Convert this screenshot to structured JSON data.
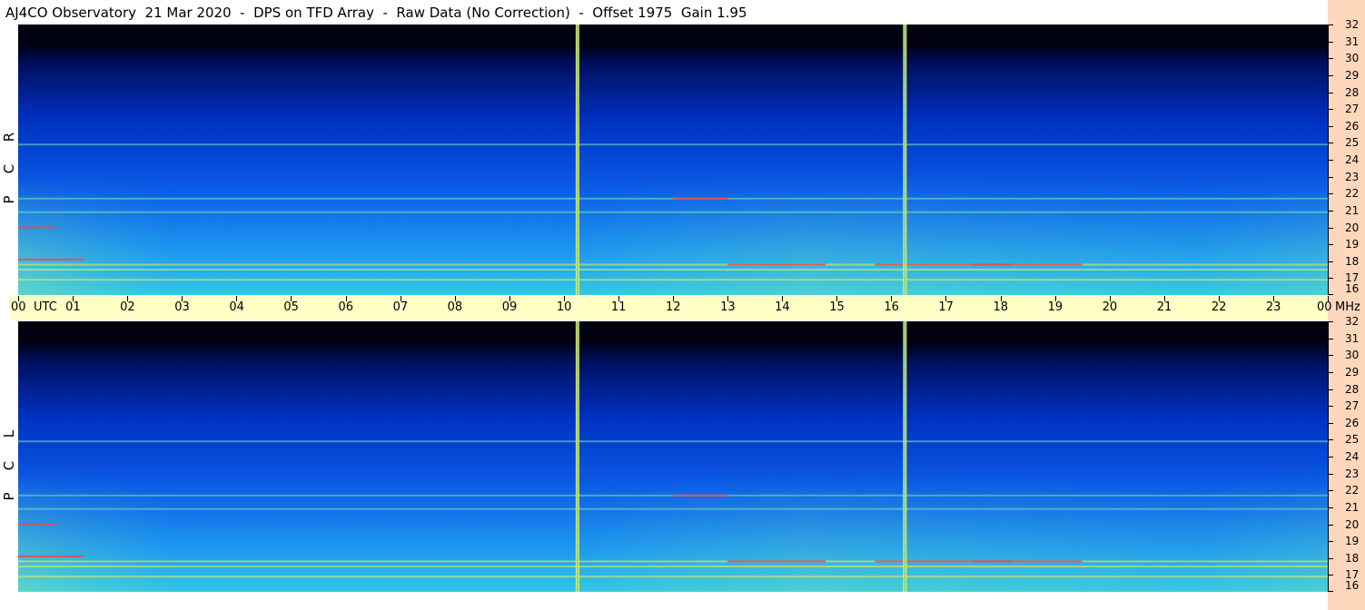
{
  "title": "AJ4CO Observatory  21 Mar 2020  -  DPS on TFD Array  -  Raw Data (No Correction)  -  Offset 1975  Gain 1.95",
  "panels": [
    {
      "id": "rcp",
      "label_letters": [
        "R",
        "C",
        "P"
      ]
    },
    {
      "id": "lcp",
      "label_letters": [
        "L",
        "C",
        "P"
      ]
    }
  ],
  "chart_data": {
    "type": "heatmap",
    "title": "AJ4CO Observatory  21 Mar 2020  -  DPS on TFD Array  -  Raw Data (No Correction)  -  Offset 1975  Gain 1.95",
    "x_unit": "UTC",
    "y_unit": "MHz",
    "x_ticks": [
      "00",
      "01",
      "02",
      "03",
      "04",
      "05",
      "06",
      "07",
      "08",
      "09",
      "10",
      "11",
      "12",
      "13",
      "14",
      "15",
      "16",
      "17",
      "18",
      "19",
      "20",
      "21",
      "22",
      "23",
      "00"
    ],
    "xlim": [
      0,
      24
    ],
    "y_ticks": [
      16,
      17,
      18,
      19,
      20,
      21,
      22,
      23,
      24,
      25,
      26,
      27,
      28,
      29,
      30,
      31,
      32
    ],
    "ylim": [
      16,
      32
    ],
    "series": [
      {
        "name": "R C P"
      },
      {
        "name": "L C P"
      }
    ],
    "colormap": [
      "#000010",
      "#001060",
      "#0030c0",
      "#0a5ae6",
      "#1e9bf0",
      "#30c8e6",
      "#7ee0b0",
      "#f0f050",
      "#ff4040"
    ],
    "interference_lines_utc": [
      10.25,
      16.25
    ],
    "strong_lines_mhz": [
      16.9,
      17.5,
      17.8,
      20.9,
      21.7,
      24.9
    ],
    "grid": false
  }
}
